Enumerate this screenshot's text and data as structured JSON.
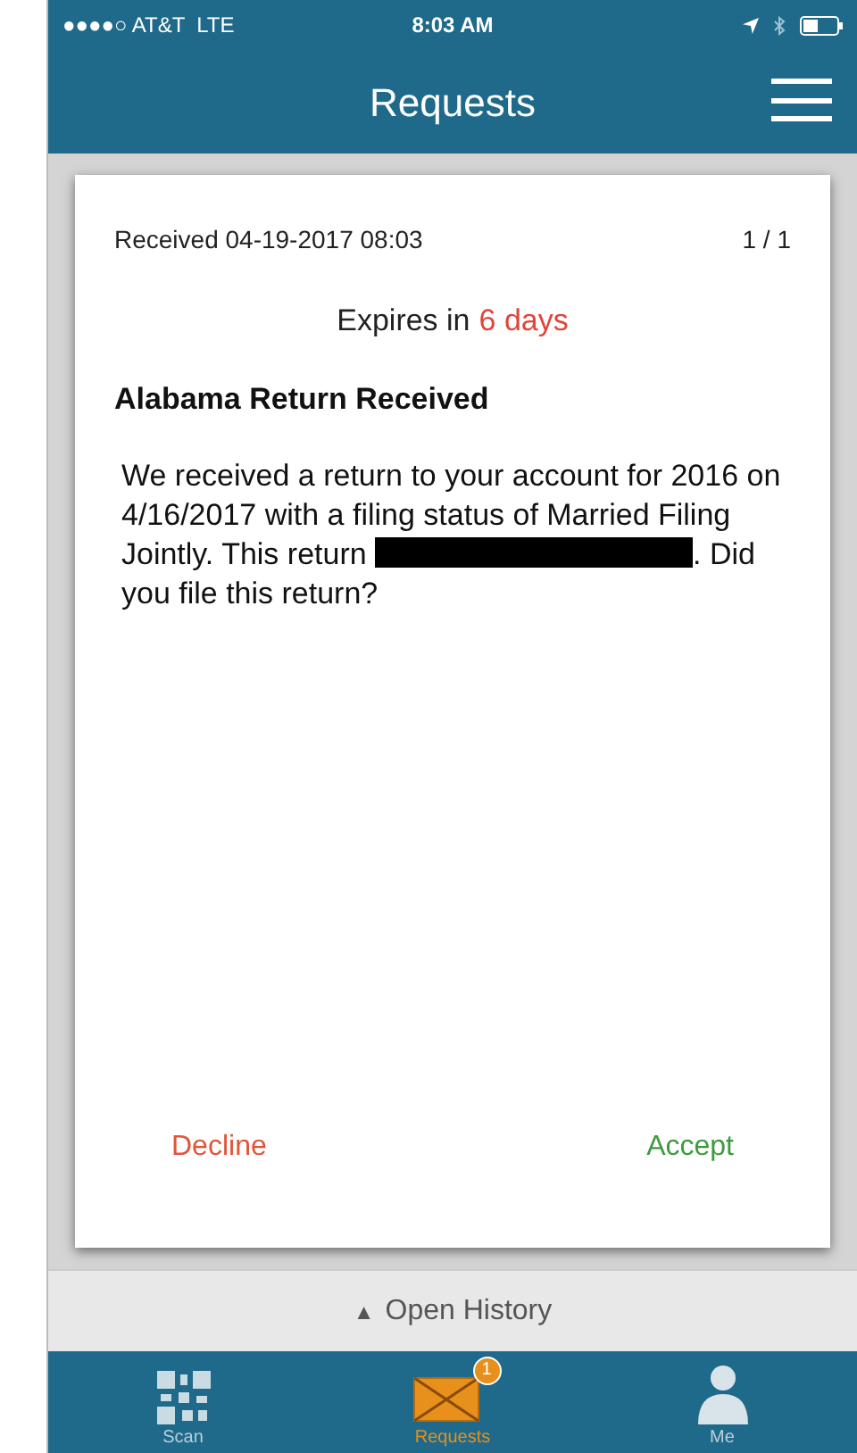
{
  "status_bar": {
    "carrier": "●●●●○ AT&T  LTE",
    "time": "8:03 AM"
  },
  "nav_bar": {
    "title": "Requests"
  },
  "request": {
    "received": "Received 04-19-2017 08:03",
    "counter": "1 / 1",
    "expires_label": "Expires in",
    "expires_value": "6 days",
    "title": "Alabama Return Received",
    "body_before": "We received a return to your account for 2016 on 4/16/2017 with a filing status of Married Filing Jointly. This return",
    "redacted": true,
    "body_after": ". Did you file this return?",
    "decline": "Decline",
    "accept": "Accept"
  },
  "history_toggle": {
    "arrow": "▲",
    "label": "Open History"
  },
  "tab_bar": [
    {
      "kind": "scan",
      "label": "Scan",
      "selected": false
    },
    {
      "kind": "requests",
      "label": "Requests",
      "selected": true,
      "badge": "1"
    },
    {
      "kind": "me",
      "label": "Me",
      "selected": false
    }
  ]
}
